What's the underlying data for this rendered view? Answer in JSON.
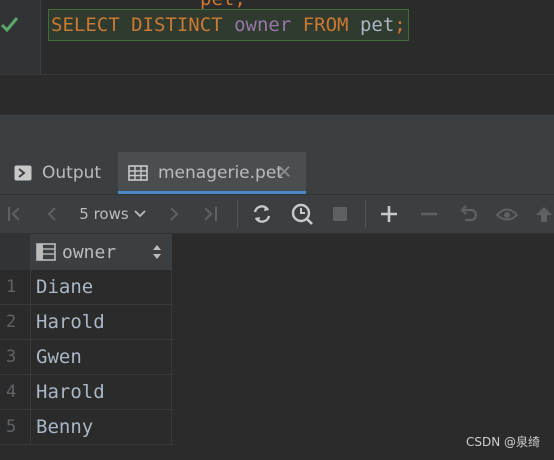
{
  "editor": {
    "clipped_text": "pet;",
    "query": {
      "select": "SELECT",
      "distinct": "DISTINCT",
      "column": "owner",
      "from": "FROM",
      "table": "pet",
      "semicolon": ";"
    },
    "status_icon": "check-icon"
  },
  "tabs": [
    {
      "label": "Output",
      "icon": "console-icon"
    },
    {
      "label": "menagerie.pet",
      "icon": "table-icon",
      "close": "✕"
    }
  ],
  "toolbar": {
    "rows_label": "5 rows",
    "icons": [
      "first-page-icon",
      "prev-page-icon",
      "next-page-icon",
      "last-page-icon",
      "reload-icon",
      "history-icon",
      "stop-icon",
      "add-row-icon",
      "delete-row-icon",
      "revert-icon",
      "preview-icon",
      "submit-icon"
    ]
  },
  "grid": {
    "column_header": "owner",
    "rows": [
      {
        "num": "1",
        "owner": "Diane"
      },
      {
        "num": "2",
        "owner": "Harold"
      },
      {
        "num": "3",
        "owner": "Gwen"
      },
      {
        "num": "4",
        "owner": "Harold"
      },
      {
        "num": "5",
        "owner": "Benny"
      }
    ]
  },
  "watermark": "CSDN @泉绮",
  "colors": {
    "keyword": "#cc7832",
    "identifier": "#9876aa",
    "accent": "#4a88c7",
    "success": "#59a869"
  }
}
